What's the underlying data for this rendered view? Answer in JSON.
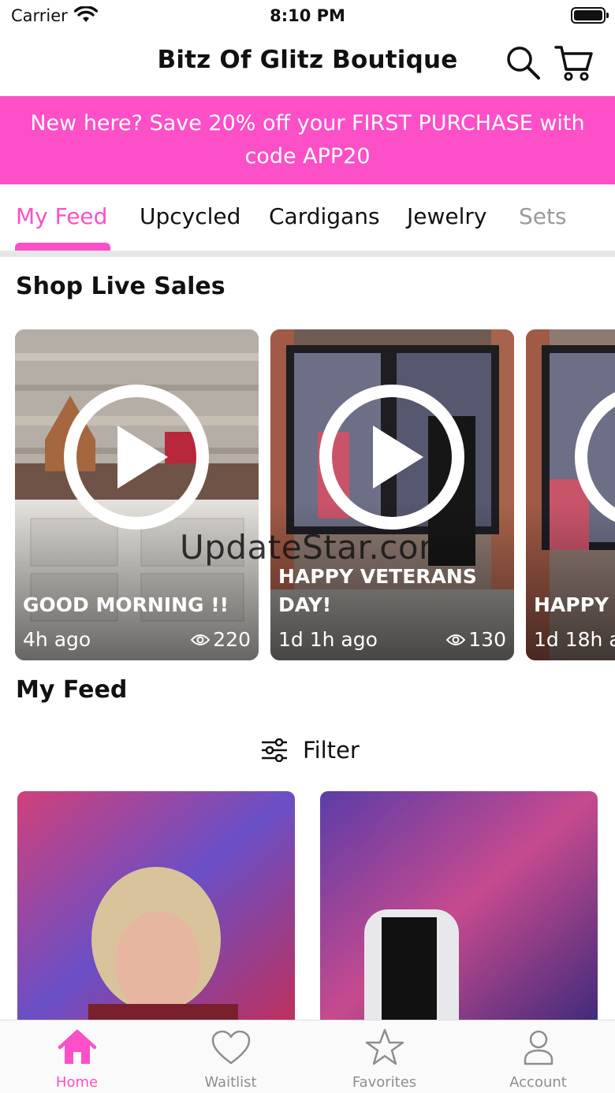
{
  "status_bar": {
    "carrier": "Carrier",
    "time": "8:10 PM"
  },
  "header": {
    "title": "Bitz Of Glitz Boutique",
    "search_icon": "search-icon",
    "cart_icon": "cart-icon"
  },
  "promo": {
    "text": "New here? Save 20% off your FIRST PURCHASE with code APP20",
    "background": "#fc4fc8"
  },
  "tabs": [
    {
      "label": "My Feed",
      "active": true
    },
    {
      "label": "Upcycled"
    },
    {
      "label": "Cardigans"
    },
    {
      "label": "Jewelry"
    },
    {
      "label": "Sets"
    }
  ],
  "live": {
    "heading": "Shop Live Sales",
    "cards": [
      {
        "title": "GOOD MORNING !!",
        "ago": "4h ago",
        "views": "220"
      },
      {
        "title": "HAPPY VETERANS DAY!",
        "ago": "1d 1h ago",
        "views": "130"
      },
      {
        "title": "HAPPY T",
        "ago": "1d 18h a",
        "views": ""
      }
    ]
  },
  "watermark": "UpdateStar.com",
  "feed": {
    "heading": "My Feed",
    "filter_label": "Filter"
  },
  "bottom_nav": [
    {
      "label": "Home",
      "icon": "home-icon",
      "active": true
    },
    {
      "label": "Waitlist",
      "icon": "heart-icon"
    },
    {
      "label": "Favorites",
      "icon": "star-icon"
    },
    {
      "label": "Account",
      "icon": "person-icon"
    }
  ],
  "colors": {
    "accent": "#fc4fc8",
    "inactive": "#8e8e8e"
  }
}
